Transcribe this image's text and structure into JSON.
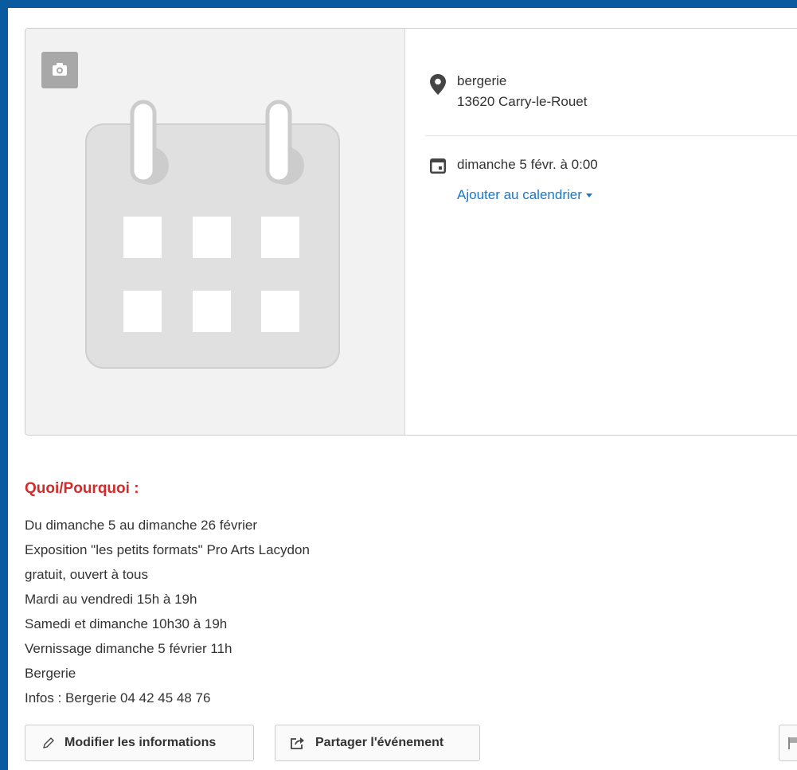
{
  "event": {
    "location_name": "bergerie",
    "location_city": "13620 Carry-le-Rouet",
    "date": "dimanche 5 févr. à 0:00",
    "add_calendar_label": "Ajouter au calendrier"
  },
  "description": {
    "title": "Quoi/Pourquoi :",
    "lines": [
      "Du dimanche 5 au dimanche 26 février",
      "Exposition \"les petits formats\" Pro Arts Lacydon",
      "gratuit, ouvert à tous",
      "Mardi au vendredi 15h à 19h",
      "Samedi et dimanche 10h30 à 19h",
      "Vernissage dimanche 5 février 11h",
      "Bergerie",
      "Infos : Bergerie 04 42 45 48 76"
    ]
  },
  "actions": {
    "edit_label": "Modifier les informations",
    "share_label": "Partager l'événement"
  },
  "colors": {
    "frame": "#0a5aa0",
    "title_red": "#d42a2a",
    "link_blue": "#1a78c8",
    "placeholder_gray": "#e0e0e0"
  },
  "icons": [
    "camera-icon",
    "calendar-placeholder-icon",
    "map-pin-icon",
    "calendar-icon",
    "caret-down-icon",
    "pencil-icon",
    "share-icon",
    "flag-icon"
  ]
}
